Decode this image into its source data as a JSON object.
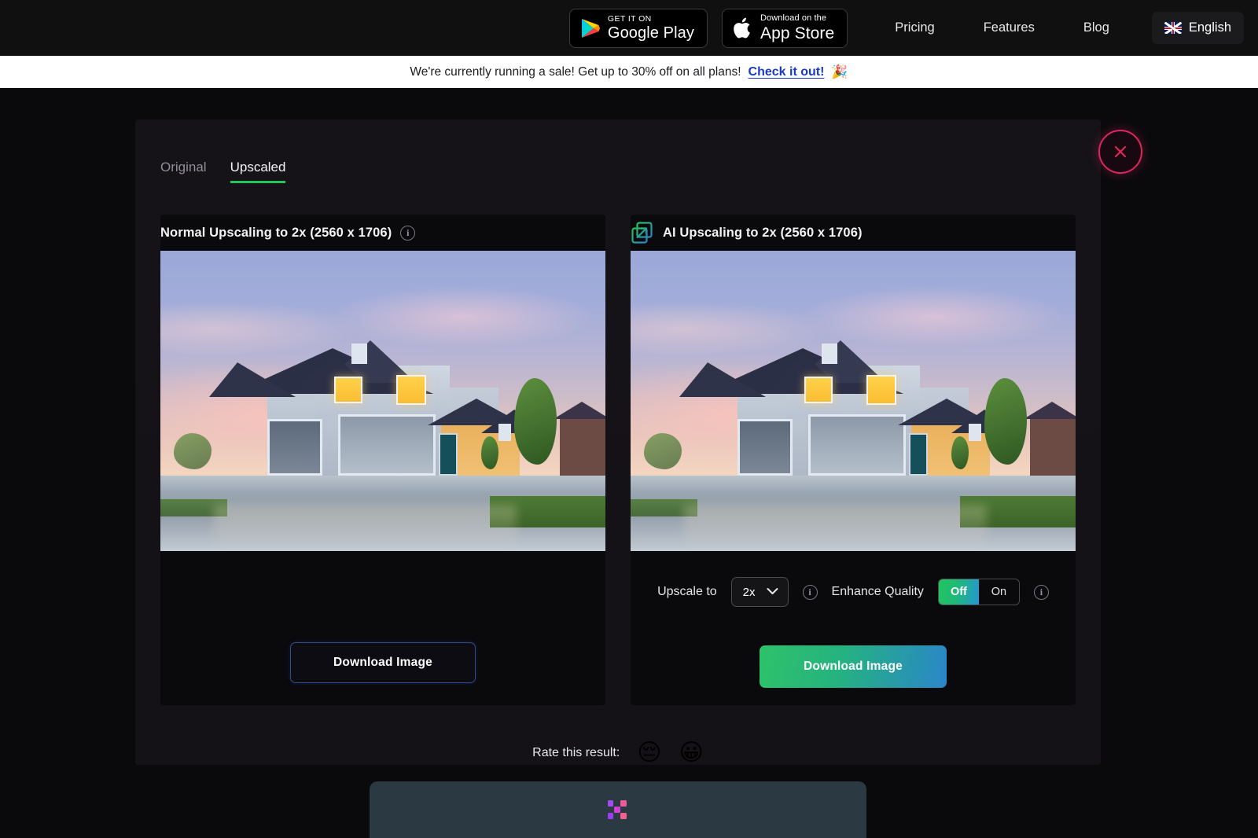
{
  "topnav": {
    "google_play": {
      "small": "GET IT ON",
      "big": "Google Play",
      "icon": "google-play-icon"
    },
    "app_store": {
      "small": "Download on the",
      "big": "App Store",
      "icon": "apple-icon"
    },
    "links": [
      "Pricing",
      "Features",
      "Blog"
    ],
    "language": {
      "label": "English",
      "flag": "uk-flag-icon"
    }
  },
  "banner": {
    "text": "We're currently running a sale! Get up to 30% off on all plans!",
    "link": "Check it out!",
    "emoji": "🎉"
  },
  "modal": {
    "close_label": "×",
    "tabs": [
      {
        "label": "Original",
        "active": false
      },
      {
        "label": "Upscaled",
        "active": true
      }
    ],
    "left": {
      "title": "Normal Upscaling to 2x (2560 x 1706)",
      "info_icon": "info-icon",
      "download_label": "Download Image"
    },
    "right": {
      "title": "AI Upscaling to 2x (2560 x 1706)",
      "icon": "ai-upscale-icon",
      "controls": {
        "upscale_to_label": "Upscale to",
        "upscale_value": "2x",
        "upscale_options": [
          "2x"
        ],
        "upscale_info_icon": "info-icon",
        "enhance_label": "Enhance Quality",
        "enhance_off": "Off",
        "enhance_on": "On",
        "enhance_selected": "Off",
        "enhance_info_icon": "info-icon"
      },
      "download_label": "Download Image"
    },
    "rate": {
      "label": "Rate this result:",
      "negative_emoji": "😔",
      "positive_emoji": "😀"
    }
  },
  "colors": {
    "accent_green": "#22c55e",
    "accent_blue": "#2a86c9",
    "close_pink": "#e0245e",
    "banner_link": "#1a39c7",
    "panel_slate": "#2b3a42"
  }
}
